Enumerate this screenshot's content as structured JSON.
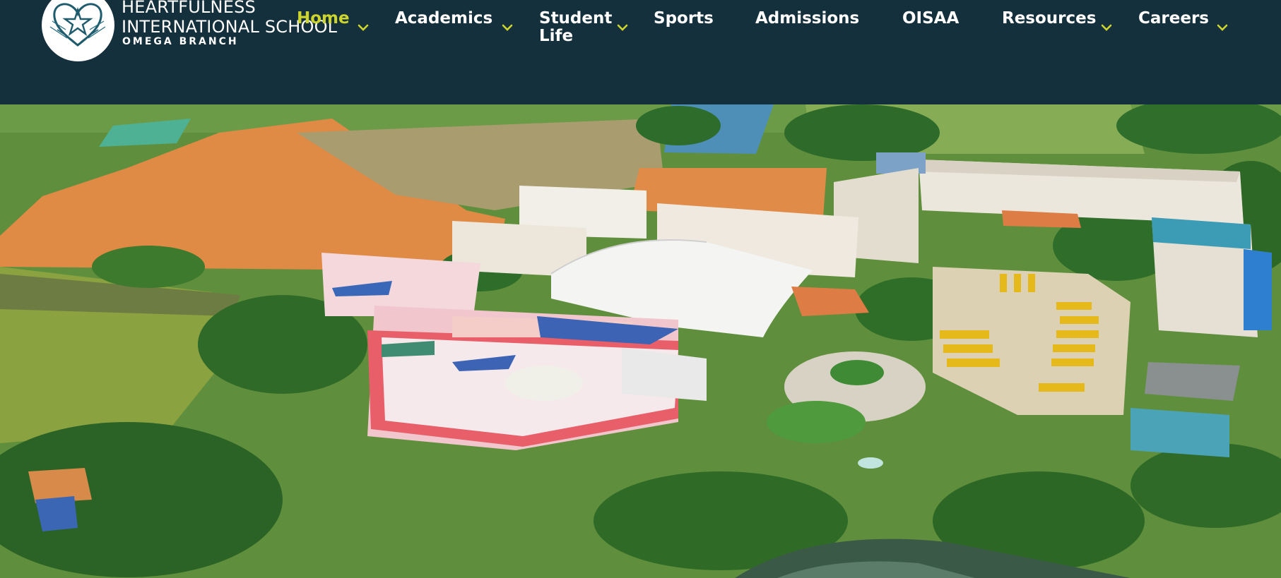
{
  "brand": {
    "name_line1": "HEARTFULNESS",
    "name_line2": "INTERNATIONAL SCHOOL",
    "branch": "OMEGA BRANCH",
    "logo_icon": "heart-star-logo-icon"
  },
  "nav": {
    "items": [
      {
        "label": "Home",
        "active": true,
        "has_dropdown": true
      },
      {
        "label": "Academics",
        "has_dropdown": true
      },
      {
        "label": "Student Life",
        "has_dropdown": true
      },
      {
        "label": "Sports",
        "has_dropdown": false
      },
      {
        "label": "Admissions",
        "has_dropdown": false
      },
      {
        "label": "OISAA",
        "has_dropdown": false
      },
      {
        "label": "Resources",
        "has_dropdown": true
      },
      {
        "label": "Careers",
        "has_dropdown": true
      }
    ],
    "dropdown_icon": "chevron-down-icon"
  },
  "colors": {
    "header_bg": "#15303d",
    "active_nav": "#cdd52c",
    "chevron": "#cdd52c",
    "nav_text": "#ffffff"
  }
}
